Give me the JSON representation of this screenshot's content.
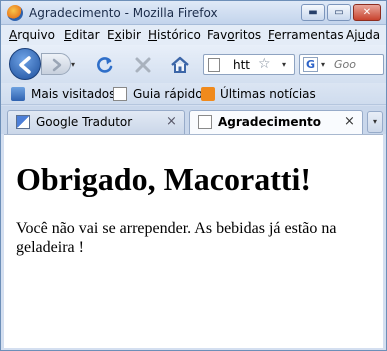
{
  "window": {
    "title": "Agradecimento - Mozilla Firefox",
    "controls": {
      "minimize": "▬",
      "maximize": "▭",
      "close": "✕"
    }
  },
  "menu": {
    "items": [
      {
        "label": "Arquivo",
        "accel": "A",
        "rest": "rquivo"
      },
      {
        "label": "Editar",
        "accel": "E",
        "rest": "ditar"
      },
      {
        "label": "Exibir",
        "accel": "x",
        "pre": "E",
        "rest": "ibir"
      },
      {
        "label": "Histórico",
        "accel": "H",
        "rest": "istórico"
      },
      {
        "label": "Favoritos",
        "accel": "o",
        "pre": "Fav",
        "rest": "ritos"
      },
      {
        "label": "Ferramentas",
        "accel": "F",
        "rest": "erramentas"
      },
      {
        "label": "Ajuda",
        "accel": "u",
        "pre": "Aj",
        "rest": "da"
      }
    ]
  },
  "nav": {
    "url_text": "htt",
    "star": "☆",
    "dropdown": "▾",
    "search_engine": "G",
    "search_placeholder": "Goo"
  },
  "bookmarks": {
    "items": [
      {
        "label": "Mais visitados",
        "icon": "smart-bookmark-icon"
      },
      {
        "label": "Guia rápido",
        "icon": "page-icon"
      },
      {
        "label": "Últimas notícias",
        "icon": "rss-icon"
      }
    ]
  },
  "tabs": [
    {
      "label": "Google Tradutor",
      "icon": "translate-icon",
      "active": false,
      "close": "×"
    },
    {
      "label": "Agradecimento",
      "icon": "document-icon",
      "active": true,
      "close": "×"
    }
  ],
  "tab_list": "▾",
  "page": {
    "heading": "Obrigado, Macoratti!",
    "paragraph": "Você não vai se arrepender. As bebidas já estão na geladeira !"
  }
}
